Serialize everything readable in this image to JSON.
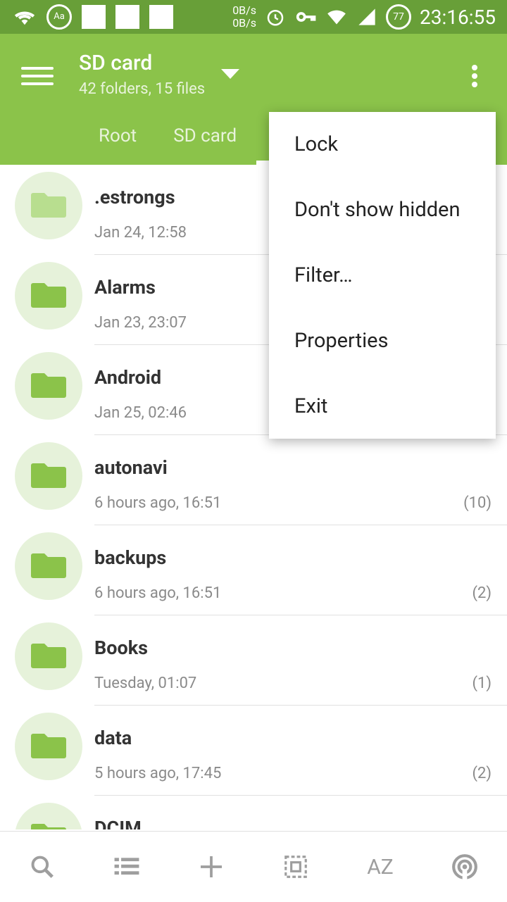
{
  "status": {
    "speed_up": "0B/s",
    "speed_down": "0B/s",
    "battery": "77",
    "time": "23:16:55"
  },
  "appbar": {
    "title": "SD card",
    "subtitle": "42 folders, 15 files",
    "breadcrumbs": [
      "Root",
      "SD card"
    ]
  },
  "menu": {
    "items": [
      "Lock",
      "Don't show hidden",
      "Filter…",
      "Properties",
      "Exit"
    ]
  },
  "files": [
    {
      "name": ".estrongs",
      "date": "Jan 24, 12:58",
      "count": ""
    },
    {
      "name": "Alarms",
      "date": "Jan 23, 23:07",
      "count": ""
    },
    {
      "name": "Android",
      "date": "Jan 25, 02:46",
      "count": ""
    },
    {
      "name": "autonavi",
      "date": "6 hours ago, 16:51",
      "count": "(10)"
    },
    {
      "name": "backups",
      "date": "6 hours ago, 16:51",
      "count": "(2)"
    },
    {
      "name": "Books",
      "date": "Tuesday, 01:07",
      "count": "(1)"
    },
    {
      "name": "data",
      "date": "5 hours ago, 17:45",
      "count": "(2)"
    },
    {
      "name": "DCIM",
      "date": "",
      "count": ""
    }
  ],
  "bottombar": {
    "sort_label": "AZ"
  },
  "colors": {
    "accent": "#8bc34a",
    "status": "#689f38"
  }
}
